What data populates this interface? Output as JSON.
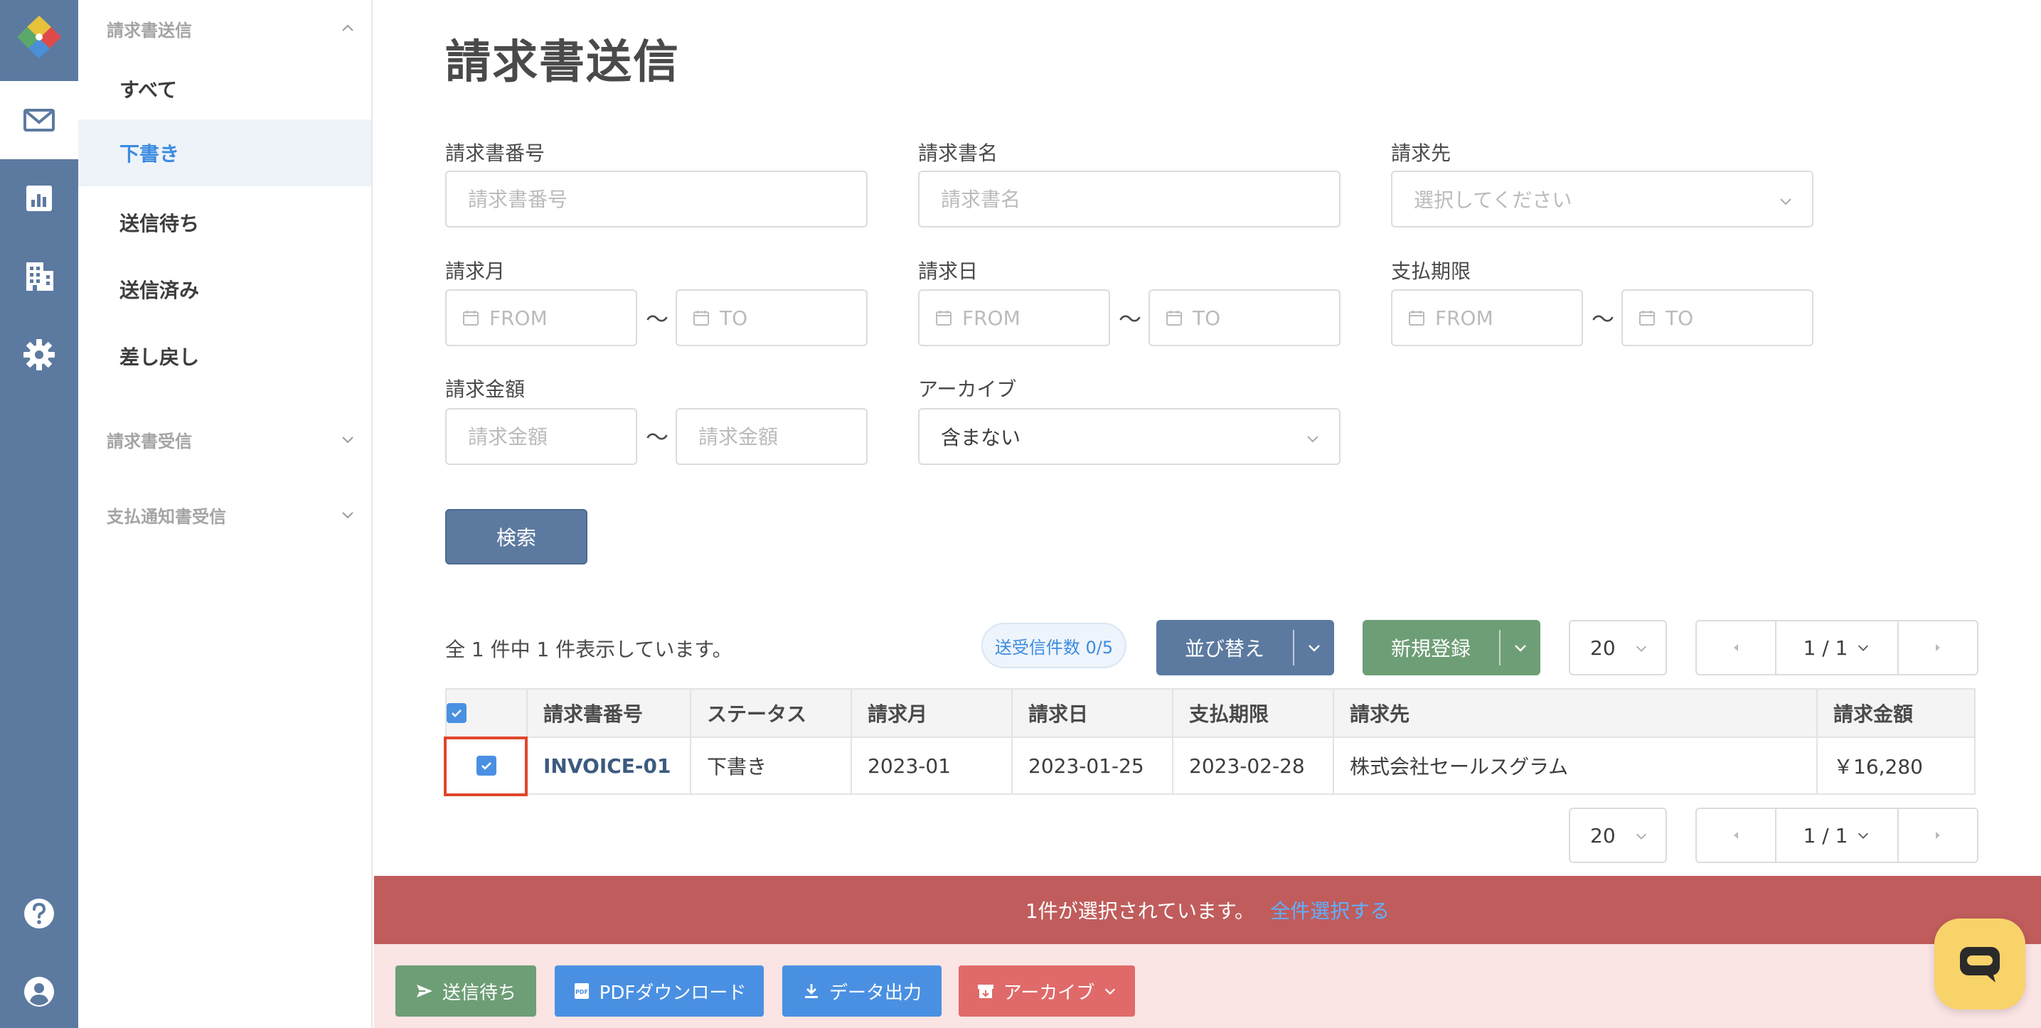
{
  "colors": {
    "rail": "#5c7aa0",
    "accent_blue": "#3b8be0",
    "sort_button": "#5c7aa0",
    "new_button": "#6e9e76",
    "selection_bar": "#c05c5c",
    "action_bar": "#fbe4e4",
    "send_wait_button": "#6e9e76",
    "pdf_button": "#4a90e2",
    "export_button": "#4a90e2",
    "archive_button": "#e06a6a",
    "chat_button": "#f8d36a"
  },
  "rail": {
    "items": [
      {
        "icon": "mail-icon",
        "active": true
      },
      {
        "icon": "chart-icon",
        "active": false
      },
      {
        "icon": "building-icon",
        "active": false
      },
      {
        "icon": "gear-icon",
        "active": false
      }
    ],
    "bottom_items": [
      {
        "icon": "help-icon"
      },
      {
        "icon": "user-icon"
      }
    ]
  },
  "sidebar": {
    "section_send": "請求書送信",
    "items": [
      {
        "label": "すべて"
      },
      {
        "label": "下書き"
      },
      {
        "label": "送信待ち"
      },
      {
        "label": "送信済み"
      },
      {
        "label": "差し戻し"
      }
    ],
    "section_receive": "請求書受信",
    "section_payment": "支払通知書受信"
  },
  "page": {
    "title": "請求書送信"
  },
  "filters": {
    "invoice_number": {
      "label": "請求書番号",
      "placeholder": "請求書番号"
    },
    "invoice_name": {
      "label": "請求書名",
      "placeholder": "請求書名"
    },
    "recipient": {
      "label": "請求先",
      "placeholder": "選択してください"
    },
    "billing_month": {
      "label": "請求月",
      "from": "FROM",
      "to": "TO"
    },
    "billing_date": {
      "label": "請求日",
      "from": "FROM",
      "to": "TO"
    },
    "due_date": {
      "label": "支払期限",
      "from": "FROM",
      "to": "TO"
    },
    "amount": {
      "label": "請求金額",
      "from_placeholder": "請求金額",
      "to_placeholder": "請求金額"
    },
    "archive": {
      "label": "アーカイブ",
      "value": "含まない"
    },
    "tilde": "〜",
    "search_button": "検索"
  },
  "results": {
    "count_text": "全 1 件中 1 件表示しています。",
    "badge": "送受信件数 0/5",
    "sort_button": "並び替え",
    "new_button": "新規登録",
    "per_page": "20",
    "page_indicator": "1 / 1"
  },
  "table": {
    "columns": [
      "請求書番号",
      "ステータス",
      "請求月",
      "請求日",
      "支払期限",
      "請求先",
      "請求金額"
    ],
    "rows": [
      {
        "invoice_number": "INVOICE-01",
        "status": "下書き",
        "month": "2023-01",
        "date": "2023-01-25",
        "due": "2023-02-28",
        "recipient": "株式会社セールスグラム",
        "amount": "￥16,280",
        "checked": true
      }
    ]
  },
  "selection": {
    "text": "1件が選択されています。",
    "select_all": "全件選択する"
  },
  "actions": {
    "send_wait": "送信待ち",
    "pdf_download": "PDFダウンロード",
    "data_export": "データ出力",
    "archive": "アーカイブ"
  }
}
